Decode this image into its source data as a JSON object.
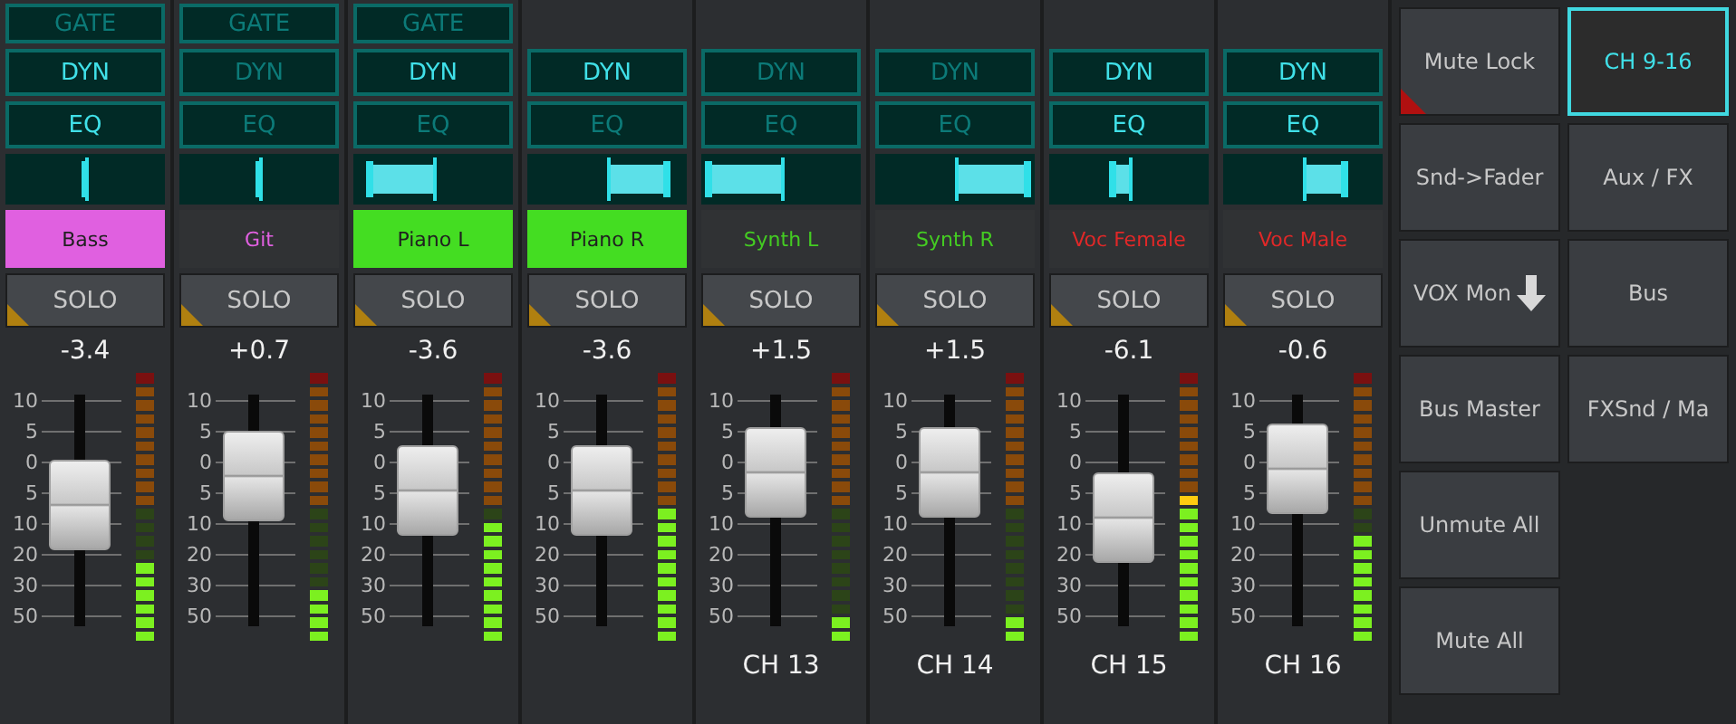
{
  "channels": [
    {
      "gate": {
        "label": "GATE",
        "on": false
      },
      "dyn": {
        "label": "DYN",
        "on": true
      },
      "eq": {
        "label": "EQ",
        "on": true
      },
      "pan": {
        "level": 0.5
      },
      "name": {
        "text": "Bass",
        "color": "#e060e0",
        "filled": true
      },
      "solo": "SOLO",
      "value": "-3.4",
      "scale": [
        "10",
        "5",
        "0",
        "5",
        "10",
        "20",
        "30",
        "50"
      ],
      "fader": {
        "level": 0.52
      },
      "meter": {
        "level": 0.3
      }
    },
    {
      "gate": {
        "label": "GATE",
        "on": false
      },
      "dyn": {
        "label": "DYN",
        "on": false
      },
      "eq": {
        "label": "EQ",
        "on": false
      },
      "pan": {
        "level": 0.5
      },
      "name": {
        "text": "Git",
        "color": "#e060e0",
        "filled": false
      },
      "solo": "SOLO",
      "value": "+0.7",
      "scale": [
        "10",
        "5",
        "0",
        "5",
        "10",
        "20",
        "30",
        "50"
      ],
      "fader": {
        "level": 0.68
      },
      "meter": {
        "level": 0.2
      }
    },
    {
      "gate": {
        "label": "GATE",
        "on": false
      },
      "dyn": {
        "label": "DYN",
        "on": true
      },
      "eq": {
        "label": "EQ",
        "on": false
      },
      "pan": {
        "level": 0.1
      },
      "name": {
        "text": "Piano L",
        "color": "#44dd22",
        "filled": true
      },
      "solo": "SOLO",
      "value": "-3.6",
      "scale": [
        "10",
        "5",
        "0",
        "5",
        "10",
        "20",
        "30",
        "50"
      ],
      "fader": {
        "level": 0.6
      },
      "meter": {
        "level": 0.45
      }
    },
    {
      "dyn": {
        "label": "DYN",
        "on": true
      },
      "eq": {
        "label": "EQ",
        "on": false
      },
      "pan": {
        "level": 0.88
      },
      "name": {
        "text": "Piano R",
        "color": "#44dd22",
        "filled": true
      },
      "solo": "SOLO",
      "value": "-3.6",
      "scale": [
        "10",
        "5",
        "0",
        "5",
        "10",
        "20",
        "30",
        "50"
      ],
      "fader": {
        "level": 0.6
      },
      "meter": {
        "level": 0.5
      }
    },
    {
      "dyn": {
        "label": "DYN",
        "on": false
      },
      "eq": {
        "label": "EQ",
        "on": false
      },
      "pan": {
        "level": 0.05
      },
      "name": {
        "text": "Synth L",
        "color": "#44cc22",
        "filled": false
      },
      "solo": "SOLO",
      "value": "+1.5",
      "scale": [
        "10",
        "5",
        "0",
        "5",
        "10",
        "20",
        "30",
        "50"
      ],
      "fader": {
        "level": 0.7
      },
      "meter": {
        "level": 0.1
      },
      "channel_label": "CH 13"
    },
    {
      "dyn": {
        "label": "DYN",
        "on": false
      },
      "eq": {
        "label": "EQ",
        "on": false
      },
      "pan": {
        "level": 0.95
      },
      "name": {
        "text": "Synth R",
        "color": "#44cc22",
        "filled": false
      },
      "solo": "SOLO",
      "value": "+1.5",
      "scale": [
        "10",
        "5",
        "0",
        "5",
        "10",
        "20",
        "30",
        "50"
      ],
      "fader": {
        "level": 0.7
      },
      "meter": {
        "level": 0.1
      },
      "channel_label": "CH 14"
    },
    {
      "dyn": {
        "label": "DYN",
        "on": true
      },
      "eq": {
        "label": "EQ",
        "on": true
      },
      "pan": {
        "level": 0.4
      },
      "name": {
        "text": "Voc Female",
        "color": "#e02828",
        "filled": false
      },
      "solo": "SOLO",
      "value": "-6.1",
      "scale": [
        "10",
        "5",
        "0",
        "5",
        "10",
        "20",
        "30",
        "50"
      ],
      "fader": {
        "level": 0.45
      },
      "meter": {
        "level": 0.55
      },
      "channel_label": "CH 15"
    },
    {
      "dyn": {
        "label": "DYN",
        "on": true
      },
      "eq": {
        "label": "EQ",
        "on": true
      },
      "pan": {
        "level": 0.76
      },
      "name": {
        "text": "Voc Male",
        "color": "#e02828",
        "filled": false
      },
      "solo": "SOLO",
      "value": "-0.6",
      "scale": [
        "10",
        "5",
        "0",
        "5",
        "10",
        "20",
        "30",
        "50"
      ],
      "fader": {
        "level": 0.72
      },
      "meter": {
        "level": 0.4
      },
      "channel_label": "CH 16"
    }
  ],
  "side_panel": {
    "left": [
      {
        "label": "Mute Lock",
        "flag": true,
        "kind": "plain"
      },
      {
        "label": "Snd->Fader",
        "flag": false,
        "kind": "plain"
      },
      {
        "label": "VOX Mon",
        "flag": false,
        "kind": "arrow"
      },
      {
        "label": "Bus Master",
        "flag": false,
        "kind": "plain"
      },
      {
        "label": "Unmute All",
        "flag": false,
        "kind": "plain"
      },
      {
        "label": "Mute All",
        "flag": false,
        "kind": "plain"
      }
    ],
    "right": [
      {
        "label": "CH 9-16",
        "selected": true
      },
      {
        "label": "Aux / FX",
        "selected": false
      },
      {
        "label": "Bus",
        "selected": false
      },
      {
        "label": "FXSnd / Ma",
        "selected": false
      }
    ]
  }
}
